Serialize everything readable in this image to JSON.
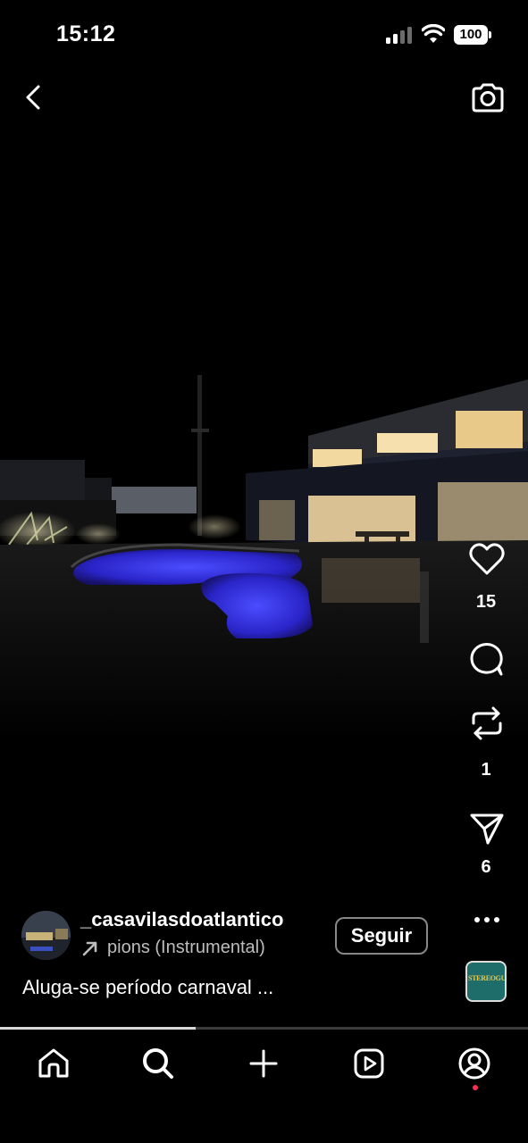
{
  "status_bar": {
    "time": "15:12",
    "battery": "100",
    "icons": [
      "signal-icon",
      "wifi-icon",
      "battery-icon"
    ]
  },
  "top_nav": {
    "back_icon": "chevron-left-icon",
    "camera_icon": "camera-icon"
  },
  "actions": {
    "like_count": "15",
    "repost_count": "1",
    "share_count": "6",
    "icons": [
      "heart-icon",
      "comment-icon",
      "repost-icon",
      "send-icon",
      "more-icon"
    ]
  },
  "post": {
    "username": "_casavilasdoatlantico",
    "audio": "pions (Instrumental)",
    "follow_label": "Seguir",
    "caption": "Aluga-se período carnaval ...",
    "audio_thumb_text": "STEREOGULLY"
  },
  "progress": {
    "fraction": 0.37
  },
  "bottom_nav": {
    "items": [
      "home-icon",
      "search-icon",
      "create-icon",
      "reels-icon",
      "profile-icon"
    ],
    "notification_color": "#ff2d55"
  }
}
